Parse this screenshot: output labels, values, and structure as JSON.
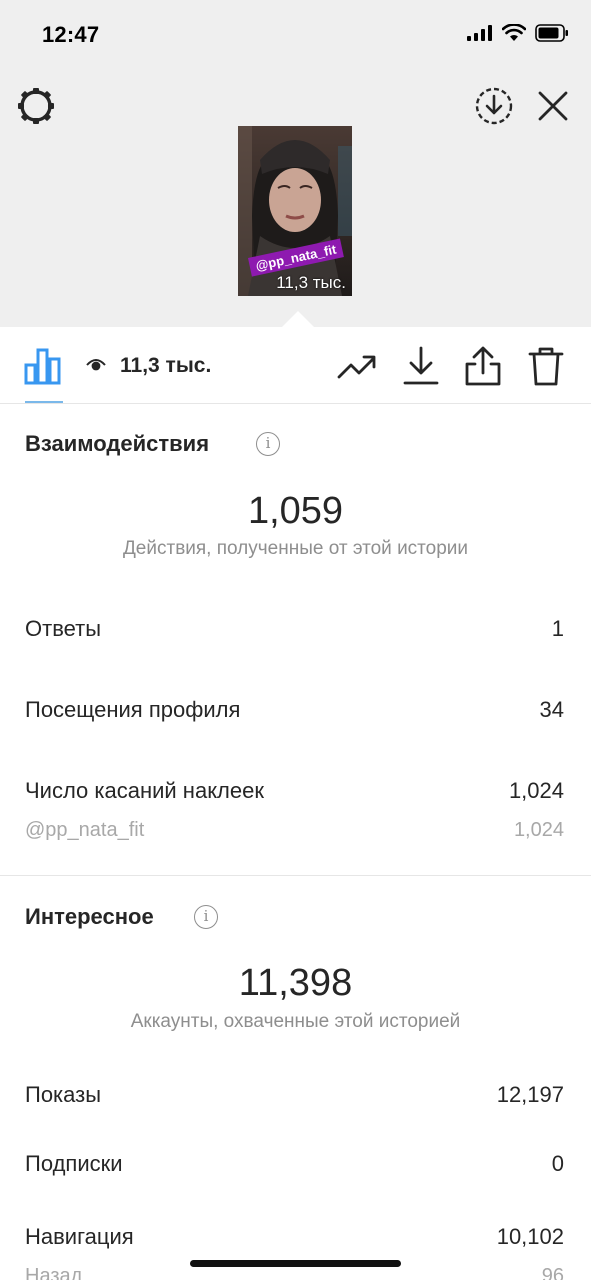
{
  "status_bar": {
    "time": "12:47"
  },
  "story_preview": {
    "tag": "@pp_nata_fit",
    "views": "11,3 тыс."
  },
  "toolbar": {
    "views": "11,3 тыс."
  },
  "interactions": {
    "title": "Взаимодействия",
    "total": "1,059",
    "caption": "Действия, полученные от этой истории",
    "rows": [
      {
        "label": "Ответы",
        "value": "1"
      },
      {
        "label": "Посещения профиля",
        "value": "34"
      },
      {
        "label": "Число касаний наклеек",
        "value": "1,024"
      },
      {
        "label": "@pp_nata_fit",
        "value": "1,024"
      }
    ]
  },
  "discovery": {
    "title": "Интересное",
    "total": "11,398",
    "caption": "Аккаунты, охваченные этой историей",
    "rows": [
      {
        "label": "Показы",
        "value": "12,197"
      },
      {
        "label": "Подписки",
        "value": "0"
      },
      {
        "label": "Навигация",
        "value": "10,102"
      },
      {
        "label": "Назад",
        "value": "96"
      }
    ]
  }
}
